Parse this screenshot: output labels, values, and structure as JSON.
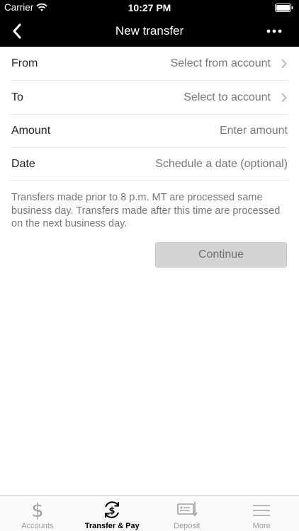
{
  "status": {
    "carrier": "Carrier",
    "time": "10:27 PM"
  },
  "nav": {
    "title": "New transfer",
    "back_icon": "chevron-left-icon",
    "more_icon": "ellipsis-icon"
  },
  "form": {
    "from": {
      "label": "From",
      "placeholder": "Select from account"
    },
    "to": {
      "label": "To",
      "placeholder": "Select to account"
    },
    "amount": {
      "label": "Amount",
      "placeholder": "Enter amount"
    },
    "date": {
      "label": "Date",
      "placeholder": "Schedule a date (optional)"
    }
  },
  "note": "Transfers made prior to 8 p.m. MT are processed same business day. Transfers made after this time are processed on the next business day.",
  "continue_label": "Continue",
  "tabs": [
    {
      "label": "Accounts",
      "icon": "dollar-icon",
      "active": false
    },
    {
      "label": "Transfer & Pay",
      "icon": "transfer-pay-icon",
      "active": true
    },
    {
      "label": "Deposit",
      "icon": "check-deposit-icon",
      "active": false
    },
    {
      "label": "More",
      "icon": "menu-icon",
      "active": false
    }
  ],
  "colors": {
    "topbar": "#000000",
    "disabled_button": "#d4d4d4",
    "placeholder": "#777777"
  }
}
